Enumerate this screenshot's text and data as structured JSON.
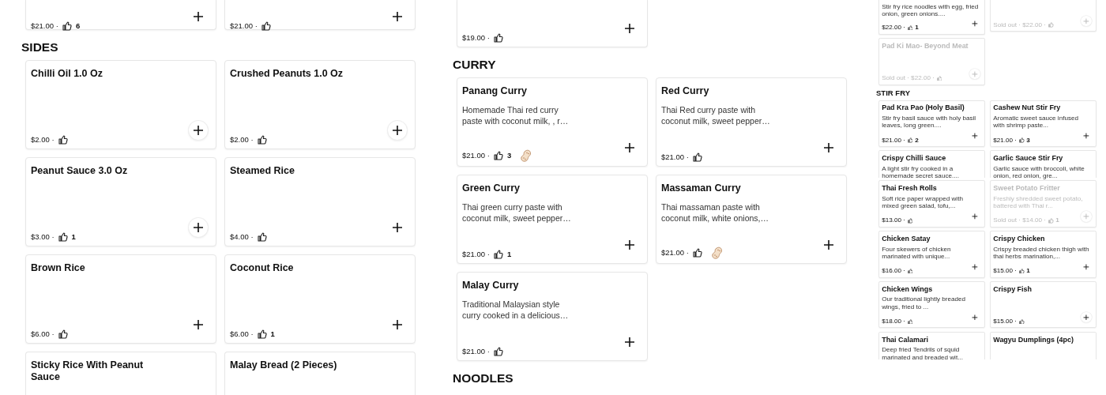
{
  "panels": [
    {
      "kind": "full",
      "sections": [
        {
          "items": [
            {
              "price": "$21.00 ·",
              "likes": "6"
            },
            {
              "price": "$21.00 ·"
            }
          ]
        },
        {
          "heading": "SIDES",
          "items": [
            {
              "name": "Chilli Oil 1.0 Oz",
              "price": "$2.00 ·",
              "ring": true
            },
            {
              "name": "Crushed Peanuts 1.0 Oz",
              "price": "$2.00 ·",
              "ring": true
            },
            {
              "name": "Peanut Sauce 3.0 Oz",
              "price": "$3.00 ·",
              "likes": "1",
              "ring": true
            },
            {
              "name": "Steamed Rice",
              "price": "$4.00 ·"
            },
            {
              "name": "Brown Rice",
              "price": "$6.00 ·"
            },
            {
              "name": "Coconut Rice",
              "price": "$6.00 ·",
              "likes": "1"
            },
            {
              "name": "Sticky Rice With Peanut Sauce"
            },
            {
              "name": "Malay Bread (2 Pieces)"
            }
          ]
        }
      ]
    },
    {
      "kind": "full",
      "sections": [
        {
          "items": [
            {
              "price": "$19.00 ·"
            }
          ]
        },
        {
          "heading": "CURRY",
          "items": [
            {
              "name": "Panang Curry",
              "description": "Homemade Thai red curry paste with coconut milk, , r…",
              "price": "$21.00 ·",
              "likes": "3",
              "peanut": true
            },
            {
              "name": "Red Curry",
              "description": "Thai Red curry paste with coconut milk, sweet pepper…",
              "price": "$21.00 ·"
            },
            {
              "name": "Green Curry",
              "description": "Thai green curry paste with coconut milk, sweet pepper…",
              "price": "$21.00 ·",
              "likes": "1"
            },
            {
              "name": "Massaman Curry",
              "description": "Thai massaman paste with coconut milk, white onions,…",
              "price": "$21.00 ·",
              "peanut": true
            },
            {
              "name": "Malay Curry",
              "description": "Traditional Malaysian style curry cooked in a delicious…",
              "price": "$21.00 ·"
            }
          ]
        },
        {
          "heading": "NOODLES"
        }
      ]
    },
    {
      "kind": "mini",
      "sections": [
        {
          "items": [
            {
              "description": "Stir fry rice noodles with egg, fried onion, green onions....",
              "price": "$22.00 ·",
              "likes": "1"
            },
            {
              "price": "Sold out · $22.00 ·",
              "sold_out": true,
              "ring": true
            },
            {
              "name": "Pad Ki Mao- Beyond Meat",
              "price": "Sold out · $22.00 ·",
              "sold_out": true,
              "ring": true
            }
          ]
        },
        {
          "heading": "STIR FRY",
          "items": [
            {
              "name": "Pad Kra Pao (Holy Basil)",
              "description": "Stir fry basil sauce with holy basil leaves, long green....",
              "price": "$21.00 ·",
              "likes": "2"
            },
            {
              "name": "Cashew Nut Stir Fry",
              "description": "Aromatic sweet sauce infused with shrimp paste...",
              "price": "$21.00 ·",
              "likes": "3"
            },
            {
              "name": "Crispy Chilli Sauce",
              "description": "A light stir fry cooked in a homemade secret sauce...."
            },
            {
              "name": "Garlic Sauce Stir Fry",
              "description": "Garlic sauce with broccoli, white onion, red onion, gre..."
            }
          ]
        },
        {
          "items": [
            {
              "name": "Thai Fresh Rolls",
              "description": "Soft rice paper wrapped with mixed green salad, tofu,...",
              "price": "$13.00 ·"
            },
            {
              "name": "Sweet Potato Fritter",
              "description": "Freshly shredded sweet potato, battered with Thai r...",
              "price": "Sold out · $14.00 ·",
              "likes": "1",
              "sold_out": true,
              "ring": true
            },
            {
              "name": "Chicken Satay",
              "description": "Four skewers of chicken marinated with unique...",
              "price": "$16.00 ·"
            },
            {
              "name": "Crispy Chicken",
              "description": "Crispy breaded chicken thigh with thai herbs marination,...",
              "price": "$15.00 ·",
              "likes": "1"
            },
            {
              "name": "Chicken Wings",
              "description": "Our traditional lightly breaded wings, fried to ...",
              "price": "$18.00 ·"
            },
            {
              "name": "Crispy Fish",
              "price": "$15.00 ·",
              "ring": true
            },
            {
              "name": "Thai Calamari",
              "description": "Deep fried Tendrils of squid marinated and breaded wit..."
            },
            {
              "name": "Wagyu Dumplings (4pc)"
            }
          ]
        }
      ]
    }
  ]
}
